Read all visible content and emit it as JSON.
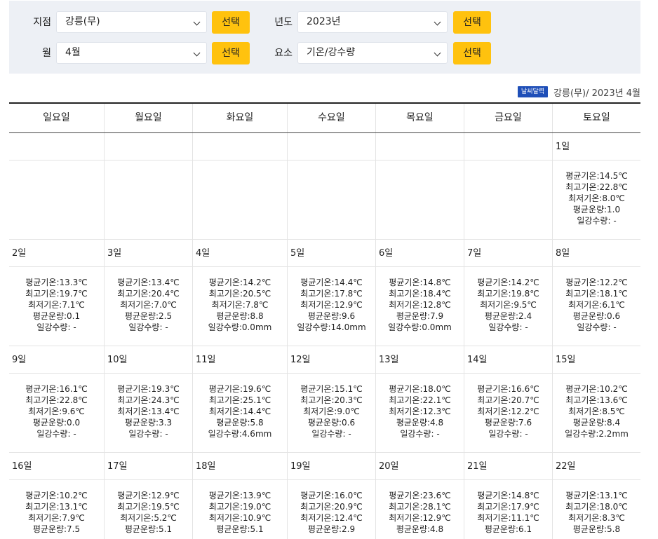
{
  "filters": {
    "station_label": "지점",
    "station_value": "강릉(무)",
    "year_label": "년도",
    "year_value": "2023년",
    "month_label": "월",
    "month_value": "4월",
    "element_label": "요소",
    "element_value": "기온/강수량",
    "select_label": "선택"
  },
  "caption": {
    "badge": "날씨달력",
    "text": "강릉(무)/ 2023년 4월"
  },
  "calendar": {
    "weekdays": [
      "일요일",
      "월요일",
      "화요일",
      "수요일",
      "목요일",
      "금요일",
      "토요일"
    ],
    "weeks": [
      {
        "days": [
          null,
          null,
          null,
          null,
          null,
          null,
          {
            "day": "1일",
            "avg": "평균기온:14.5℃",
            "max": "최고기온:22.8℃",
            "min": "최저기온:8.0℃",
            "cloud": "평균운량:1.0",
            "rain": "일강수량: -"
          }
        ]
      },
      {
        "days": [
          {
            "day": "2일",
            "avg": "평균기온:13.3℃",
            "max": "최고기온:19.7℃",
            "min": "최저기온:7.1℃",
            "cloud": "평균운량:0.1",
            "rain": "일강수량: -"
          },
          {
            "day": "3일",
            "avg": "평균기온:13.4℃",
            "max": "최고기온:20.4℃",
            "min": "최저기온:7.0℃",
            "cloud": "평균운량:2.5",
            "rain": "일강수량: -"
          },
          {
            "day": "4일",
            "avg": "평균기온:14.2℃",
            "max": "최고기온:20.5℃",
            "min": "최저기온:7.8℃",
            "cloud": "평균운량:8.8",
            "rain": "일강수량:0.0mm"
          },
          {
            "day": "5일",
            "avg": "평균기온:14.4℃",
            "max": "최고기온:17.8℃",
            "min": "최저기온:12.9℃",
            "cloud": "평균운량:9.6",
            "rain": "일강수량:14.0mm"
          },
          {
            "day": "6일",
            "avg": "평균기온:14.8℃",
            "max": "최고기온:18.4℃",
            "min": "최저기온:12.8℃",
            "cloud": "평균운량:7.9",
            "rain": "일강수량:0.0mm"
          },
          {
            "day": "7일",
            "avg": "평균기온:14.2℃",
            "max": "최고기온:19.8℃",
            "min": "최저기온:9.5℃",
            "cloud": "평균운량:2.4",
            "rain": "일강수량: -"
          },
          {
            "day": "8일",
            "avg": "평균기온:12.2℃",
            "max": "최고기온:18.1℃",
            "min": "최저기온:6.1℃",
            "cloud": "평균운량:0.6",
            "rain": "일강수량: -"
          }
        ]
      },
      {
        "days": [
          {
            "day": "9일",
            "avg": "평균기온:16.1℃",
            "max": "최고기온:22.8℃",
            "min": "최저기온:9.6℃",
            "cloud": "평균운량:0.0",
            "rain": "일강수량: -"
          },
          {
            "day": "10일",
            "avg": "평균기온:19.3℃",
            "max": "최고기온:24.3℃",
            "min": "최저기온:13.4℃",
            "cloud": "평균운량:3.3",
            "rain": "일강수량: -"
          },
          {
            "day": "11일",
            "avg": "평균기온:19.6℃",
            "max": "최고기온:25.1℃",
            "min": "최저기온:14.4℃",
            "cloud": "평균운량:5.8",
            "rain": "일강수량:4.6mm"
          },
          {
            "day": "12일",
            "avg": "평균기온:15.1℃",
            "max": "최고기온:20.3℃",
            "min": "최저기온:9.0℃",
            "cloud": "평균운량:0.6",
            "rain": "일강수량: -"
          },
          {
            "day": "13일",
            "avg": "평균기온:18.0℃",
            "max": "최고기온:22.1℃",
            "min": "최저기온:12.3℃",
            "cloud": "평균운량:4.8",
            "rain": "일강수량: -"
          },
          {
            "day": "14일",
            "avg": "평균기온:16.6℃",
            "max": "최고기온:20.7℃",
            "min": "최저기온:12.2℃",
            "cloud": "평균운량:7.6",
            "rain": "일강수량: -"
          },
          {
            "day": "15일",
            "avg": "평균기온:10.2℃",
            "max": "최고기온:13.6℃",
            "min": "최저기온:8.5℃",
            "cloud": "평균운량:8.4",
            "rain": "일강수량:2.2mm"
          }
        ]
      },
      {
        "days": [
          {
            "day": "16일",
            "avg": "평균기온:10.2℃",
            "max": "최고기온:13.1℃",
            "min": "최저기온:7.9℃",
            "cloud": "평균운량:7.5",
            "rain": ""
          },
          {
            "day": "17일",
            "avg": "평균기온:12.9℃",
            "max": "최고기온:19.5℃",
            "min": "최저기온:5.2℃",
            "cloud": "평균운량:5.1",
            "rain": ""
          },
          {
            "day": "18일",
            "avg": "평균기온:13.9℃",
            "max": "최고기온:19.0℃",
            "min": "최저기온:10.9℃",
            "cloud": "평균운량:5.1",
            "rain": ""
          },
          {
            "day": "19일",
            "avg": "평균기온:16.0℃",
            "max": "최고기온:20.9℃",
            "min": "최저기온:12.4℃",
            "cloud": "평균운량:2.9",
            "rain": ""
          },
          {
            "day": "20일",
            "avg": "평균기온:23.6℃",
            "max": "최고기온:28.1℃",
            "min": "최저기온:12.9℃",
            "cloud": "평균운량:4.8",
            "rain": ""
          },
          {
            "day": "21일",
            "avg": "평균기온:14.8℃",
            "max": "최고기온:17.9℃",
            "min": "최저기온:11.1℃",
            "cloud": "평균운량:6.1",
            "rain": ""
          },
          {
            "day": "22일",
            "avg": "평균기온:13.1℃",
            "max": "최고기온:18.0℃",
            "min": "최저기온:8.3℃",
            "cloud": "평균운량:5.8",
            "rain": ""
          }
        ]
      }
    ]
  }
}
